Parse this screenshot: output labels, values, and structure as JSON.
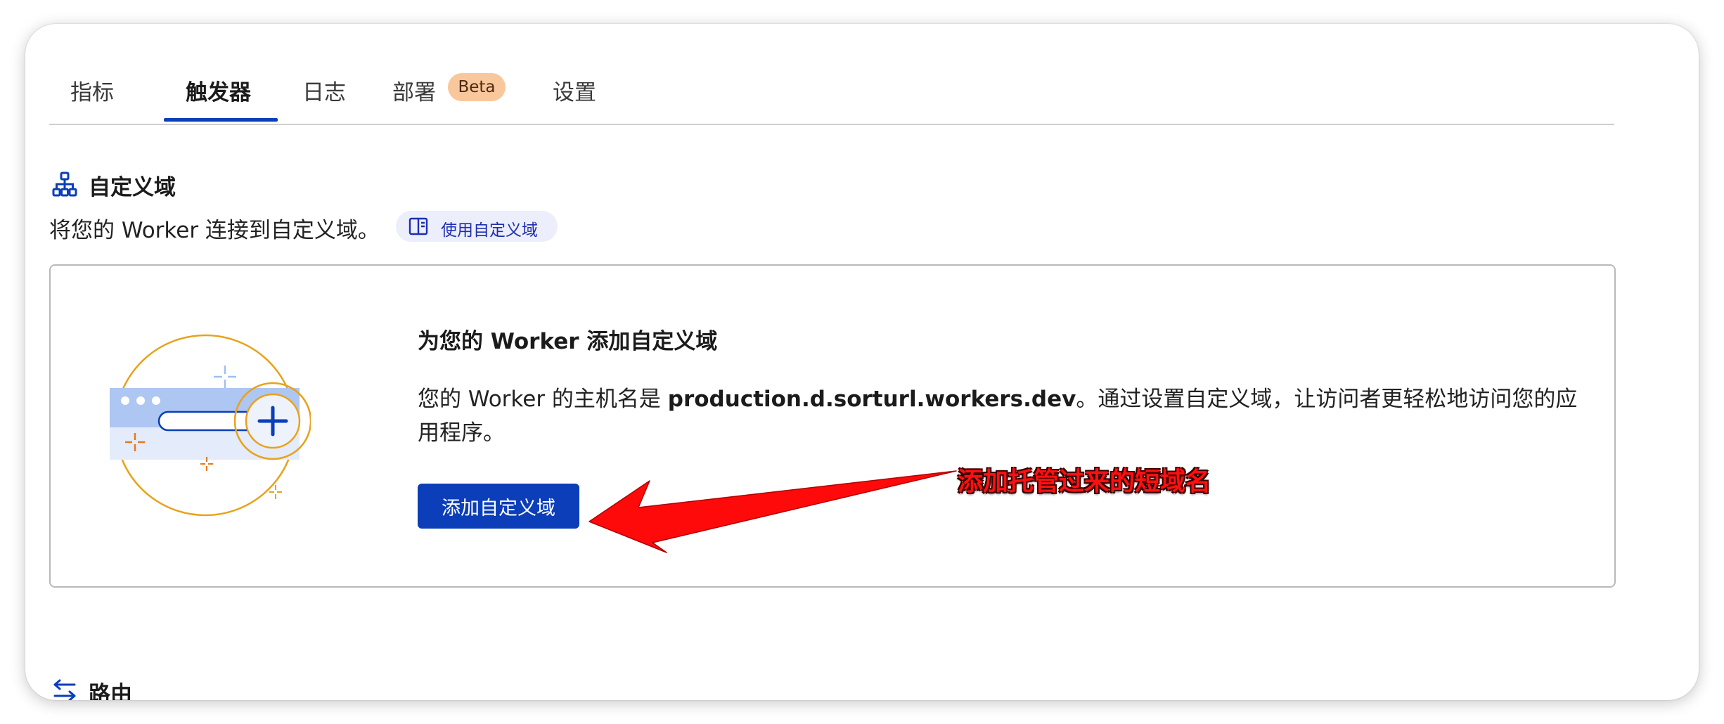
{
  "tabs": [
    {
      "label": "指标"
    },
    {
      "label": "触发器"
    },
    {
      "label": "日志"
    },
    {
      "label": "部署"
    },
    {
      "label": "设置"
    }
  ],
  "beta_badge": "Beta",
  "custom_domain": {
    "title": "自定义域",
    "description": "将您的 Worker 连接到自定义域。",
    "doc_link": "使用自定义域",
    "card": {
      "title": "为您的 Worker 添加自定义域",
      "body_prefix": "您的 Worker 的主机名是 ",
      "hostname": "production.d.sorturl.workers.dev",
      "body_suffix": "。通过设置自定义域，让访问者更轻松地访问您的应用程序。",
      "button": "添加自定义域"
    }
  },
  "annotation": "添加托管过来的短域名",
  "routes": {
    "title": "路由"
  },
  "colors": {
    "accent": "#0b3eb8",
    "badge_bg": "#f9c79c",
    "arrow": "#ff0a0a",
    "illustration_orange": "#e8a21a"
  },
  "icons": {
    "domain": "sitemap-icon",
    "doc": "book-icon",
    "routes": "swap-arrows-icon",
    "plus": "plus-icon"
  }
}
